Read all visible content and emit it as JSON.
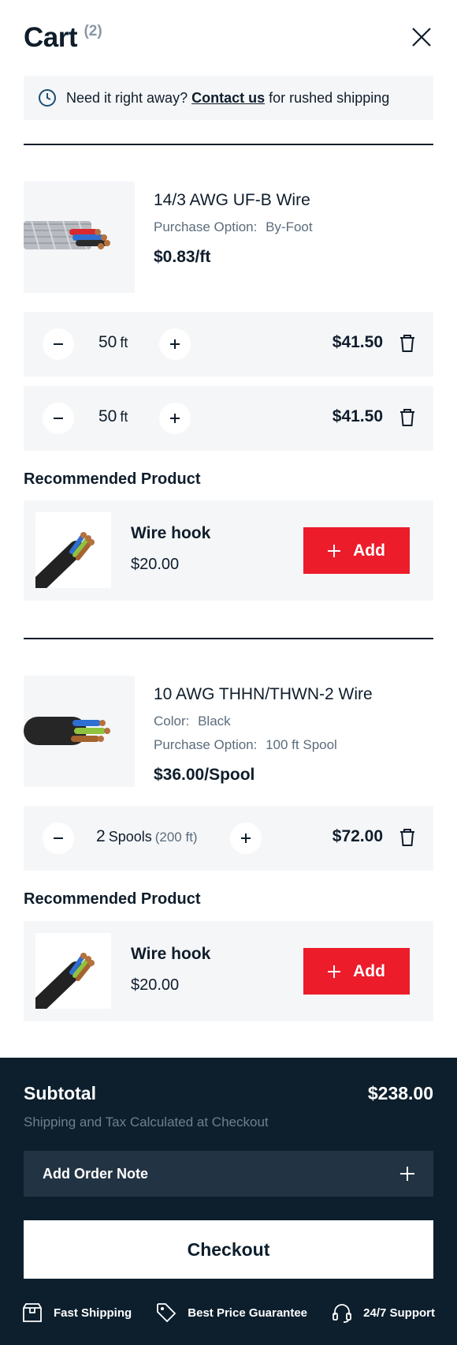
{
  "header": {
    "title": "Cart",
    "count": "(2)"
  },
  "notice": {
    "prefix": "Need it right away?",
    "link": "Contact us",
    "suffix": "for rushed shipping"
  },
  "items": [
    {
      "name": "14/3 AWG UF-B Wire",
      "meta": [
        {
          "label": "Purchase Option:",
          "value": "By-Foot"
        }
      ],
      "price": "$0.83/ft",
      "lines": [
        {
          "qty": "50",
          "unit": "ft",
          "total": "$41.50"
        },
        {
          "qty": "50",
          "unit": "ft",
          "total": "$41.50"
        }
      ]
    },
    {
      "name": "10 AWG THHN/THWN-2 Wire",
      "meta": [
        {
          "label": "Color:",
          "value": "Black"
        },
        {
          "label": "Purchase Option:",
          "value": "100 ft Spool"
        }
      ],
      "price": "$36.00/Spool",
      "lines": [
        {
          "qty": "2",
          "unit": "Spools",
          "extra": "(200 ft)",
          "total": "$72.00"
        }
      ]
    }
  ],
  "recommended": [
    {
      "heading": "Recommended Product",
      "name": "Wire hook",
      "price": "$20.00",
      "button": "Add"
    },
    {
      "heading": "Recommended Product",
      "name": "Wire hook",
      "price": "$20.00",
      "button": "Add"
    }
  ],
  "footer": {
    "subtotal_label": "Subtotal",
    "subtotal_value": "$238.00",
    "note": "Shipping and Tax Calculated at Checkout",
    "order_note": "Add Order Note",
    "checkout": "Checkout",
    "perks": [
      "Fast Shipping",
      "Best Price Guarantee",
      "24/7 Support"
    ]
  },
  "icons": {
    "close": "close-icon",
    "clock": "clock-icon",
    "minus": "minus-icon",
    "plus": "plus-icon",
    "trash": "trash-icon",
    "box": "box-icon",
    "tag": "tag-icon",
    "headset": "headset-icon"
  },
  "colors": {
    "accent": "#ec1c2b",
    "dark": "#0d1f2d",
    "panel": "#f5f6f8"
  }
}
